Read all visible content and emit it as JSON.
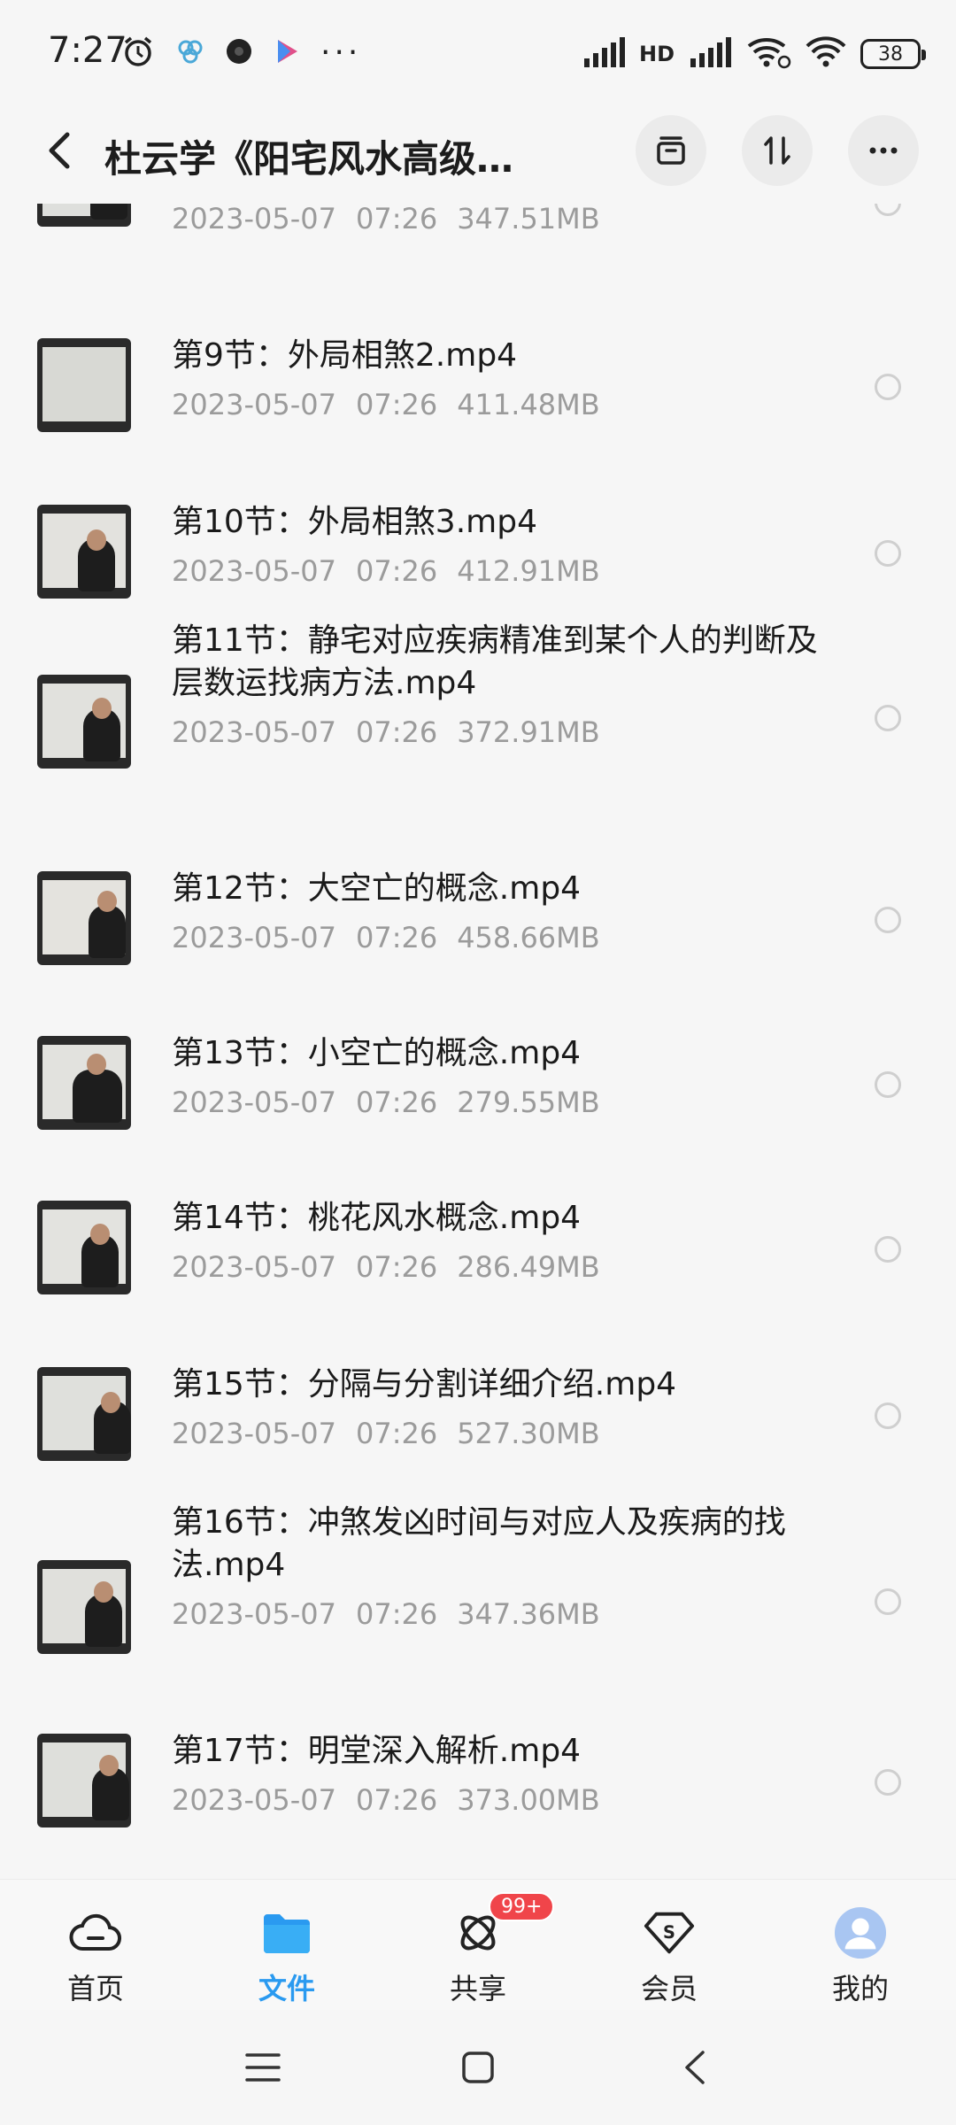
{
  "status_bar": {
    "time": "7:27",
    "overflow": "···",
    "network_label": "HD",
    "battery": "38"
  },
  "header": {
    "title": "杜云学《阳宅风水高级…",
    "actions": [
      "archive-icon",
      "sort-icon",
      "more-icon"
    ]
  },
  "files": [
    {
      "name": "",
      "date": "2023-05-07",
      "time": "07:26",
      "size": "347.51MB"
    },
    {
      "name": "第9节：外局相煞2.mp4",
      "date": "2023-05-07",
      "time": "07:26",
      "size": "411.48MB"
    },
    {
      "name": "第10节：外局相煞3.mp4",
      "date": "2023-05-07",
      "time": "07:26",
      "size": "412.91MB"
    },
    {
      "name": "第11节：静宅对应疾病精准到某个人的判断及层数运找病方法.mp4",
      "date": "2023-05-07",
      "time": "07:26",
      "size": "372.91MB"
    },
    {
      "name": "第12节：大空亡的概念.mp4",
      "date": "2023-05-07",
      "time": "07:26",
      "size": "458.66MB"
    },
    {
      "name": "第13节：小空亡的概念.mp4",
      "date": "2023-05-07",
      "time": "07:26",
      "size": "279.55MB"
    },
    {
      "name": "第14节：桃花风水概念.mp4",
      "date": "2023-05-07",
      "time": "07:26",
      "size": "286.49MB"
    },
    {
      "name": "第15节：分隔与分割详细介绍.mp4",
      "date": "2023-05-07",
      "time": "07:26",
      "size": "527.30MB"
    },
    {
      "name": "第16节：冲煞发凶时间与对应人及疾病的找法.mp4",
      "date": "2023-05-07",
      "time": "07:26",
      "size": "347.36MB"
    },
    {
      "name": "第17节：明堂深入解析.mp4",
      "date": "2023-05-07",
      "time": "07:26",
      "size": "373.00MB"
    }
  ],
  "bottom_nav": [
    {
      "label": "首页",
      "icon": "cloud-home-icon",
      "active": false
    },
    {
      "label": "文件",
      "icon": "folder-icon",
      "active": true
    },
    {
      "label": "共享",
      "icon": "share-icon",
      "active": false,
      "badge": "99+"
    },
    {
      "label": "会员",
      "icon": "vip-icon",
      "active": false
    },
    {
      "label": "我的",
      "icon": "avatar-icon",
      "active": false
    }
  ],
  "colors": {
    "accent": "#2a9af0",
    "badge": "#f0454a",
    "meta_text": "#9b9b9b",
    "background": "#f6f6f6"
  }
}
